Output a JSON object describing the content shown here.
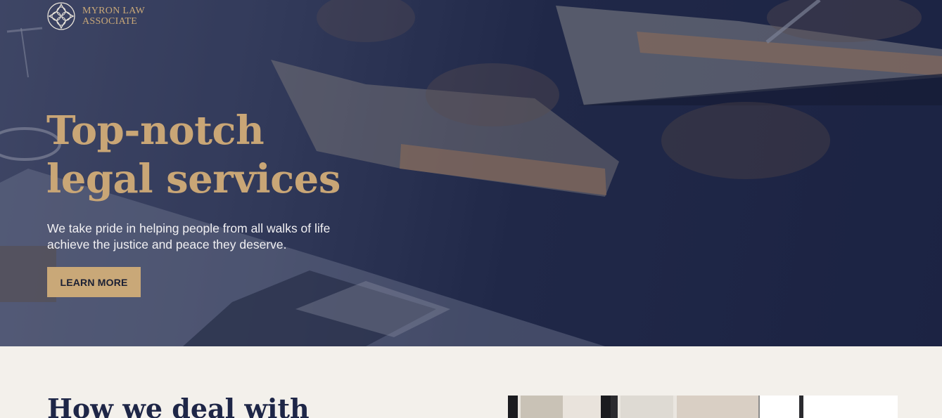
{
  "brand": {
    "name_line1": "MYRON LAW",
    "name_line2": "ASSOCIATE",
    "logo_icon": "compass-knot-icon"
  },
  "hero": {
    "title_line1": "Top-notch",
    "title_line2": "legal services",
    "subtitle": "We take pride in helping people from all walks of life achieve the justice and peace they deserve.",
    "cta_label": "LEARN MORE",
    "background": "lawyers-reading-books-photo"
  },
  "section": {
    "title": "How we deal with",
    "image": "office-interior-photo"
  },
  "colors": {
    "accent": "#c9a878",
    "navy": "#1e2647",
    "cream": "#f3f0eb"
  }
}
